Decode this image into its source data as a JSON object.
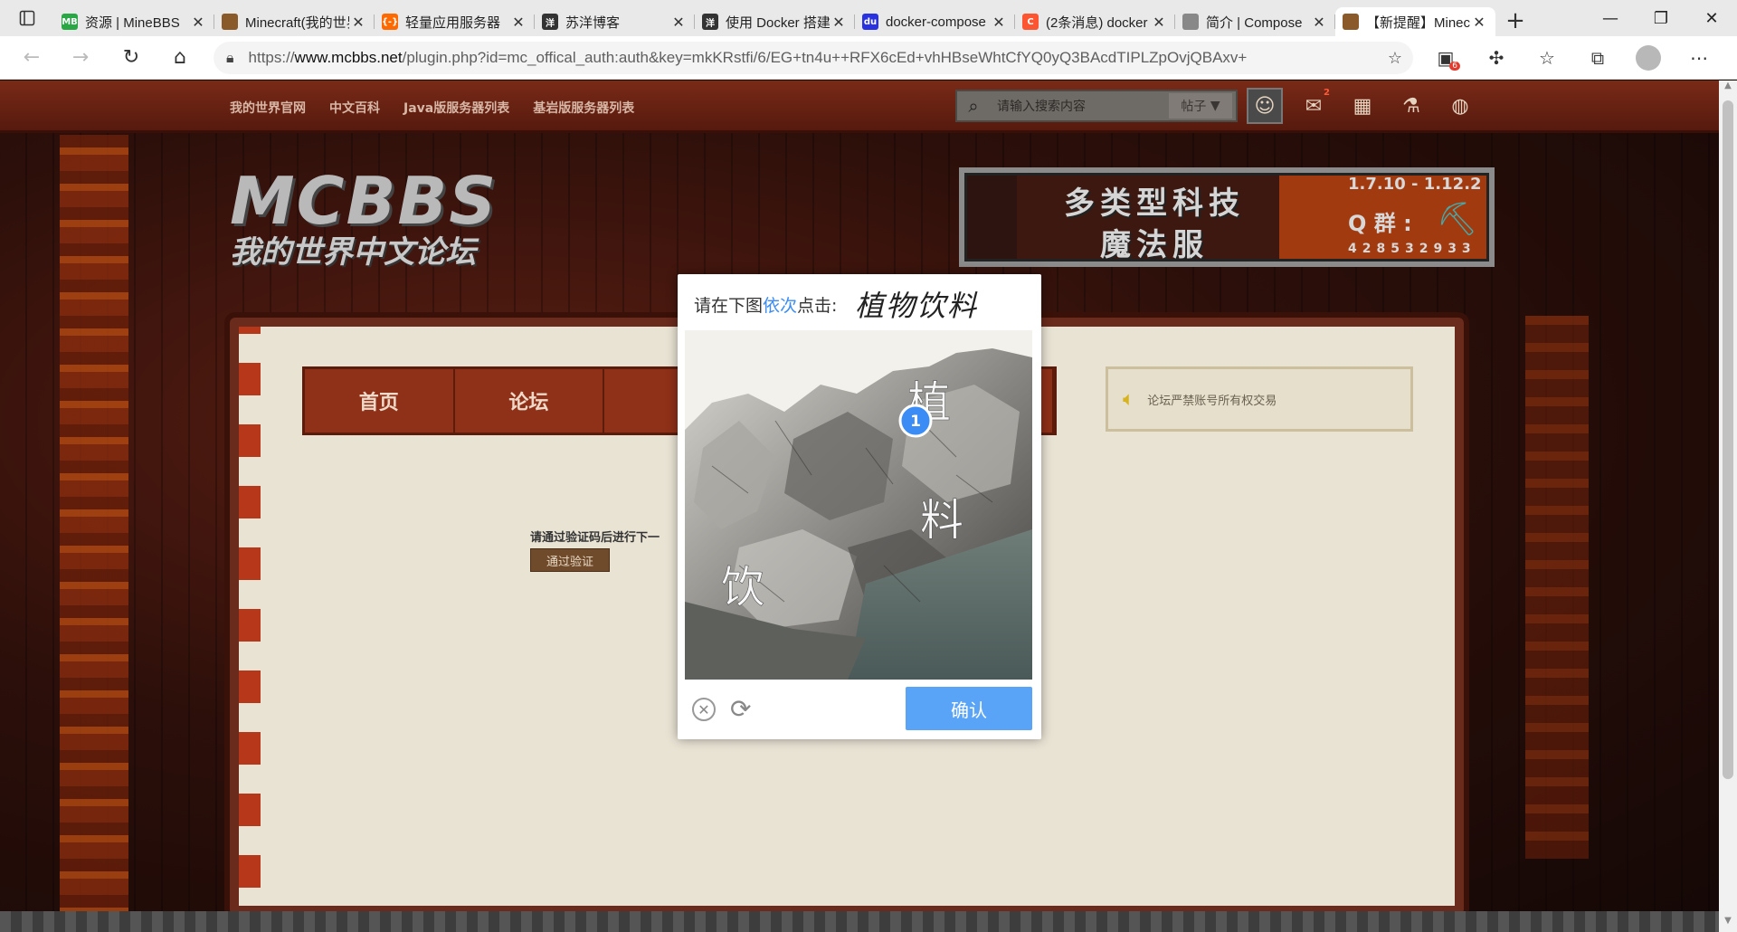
{
  "browser": {
    "tabs": [
      {
        "title": "资源 | MineBBS",
        "favicon_text": "MB",
        "favicon_color": "#2aa745"
      },
      {
        "title": "Minecraft(我的世界)",
        "favicon_text": "",
        "favicon_color": "#8a5a2b"
      },
      {
        "title": "轻量应用服务器",
        "favicon_text": "{-}",
        "favicon_color": "#ff6a00"
      },
      {
        "title": "苏洋博客",
        "favicon_text": "洋",
        "favicon_color": "#333333"
      },
      {
        "title": "使用 Docker 搭建",
        "favicon_text": "洋",
        "favicon_color": "#333333"
      },
      {
        "title": "docker-compose",
        "favicon_text": "du",
        "favicon_color": "#2932e1"
      },
      {
        "title": "(2条消息) docker",
        "favicon_text": "C",
        "favicon_color": "#fc5531"
      },
      {
        "title": "简介 | Compose",
        "favicon_text": "",
        "favicon_color": "#888888"
      },
      {
        "title": "【新提醒】Minecraft",
        "favicon_text": "",
        "favicon_color": "#8a5a2b"
      }
    ],
    "url_prefix": "https://",
    "url_host": "www.mcbbs.net",
    "url_rest": "/plugin.php?id=mc_offical_auth:auth&key=mkKRstfi/6/EG+tn4u++RFX6cEd+vhHBseWhtCfYQ0yQ3BAcdTIPLZpOvjQBAxv+",
    "extension_badge": "6"
  },
  "site": {
    "nav_links": [
      "我的世界官网",
      "中文百科",
      "Java版服务器列表",
      "基岩版服务器列表"
    ],
    "search_placeholder": "请输入搜索内容",
    "search_type": "帖子",
    "notification_badge": "2",
    "logo_line1": "MCBBS",
    "logo_line2": "我的世界中文论坛",
    "banner": {
      "line1": "多类型科技",
      "line2": "魔法服",
      "version": "1.7.10 - 1.12.2",
      "qq_label": "Q 群 :",
      "qq_number": "428532933"
    },
    "menu": [
      "首页",
      "论坛"
    ],
    "notice": "论坛严禁账号所有权交易",
    "verify_message": "请通过验证码后进行下一",
    "verify_button": "通过验证"
  },
  "captcha": {
    "prompt_before": "请在下图",
    "prompt_highlight": "依次",
    "prompt_after": "点击:",
    "target_text": "植物饮料",
    "chars_in_image": [
      "植",
      "料",
      "饮"
    ],
    "click_marker": "1",
    "confirm_label": "确认",
    "highlight_color": "#3b8cf4",
    "confirm_color": "#5aa4f8"
  }
}
